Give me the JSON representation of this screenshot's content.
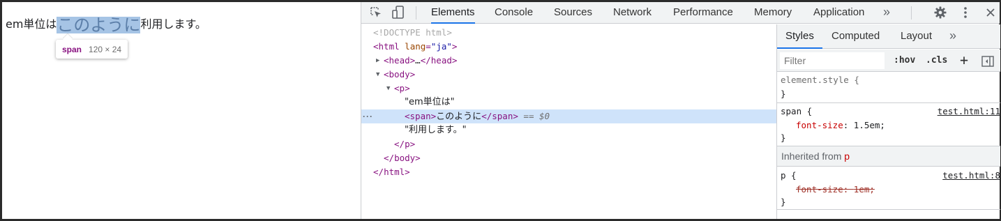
{
  "page": {
    "text_before": "em単位は",
    "text_highlight": "このように",
    "text_after": "利用します。",
    "tooltip_tag": "span",
    "tooltip_dims": "120 × 24"
  },
  "devtools": {
    "tabs": [
      "Elements",
      "Console",
      "Sources",
      "Network",
      "Performance",
      "Memory",
      "Application"
    ],
    "more": "»",
    "icons": [
      "inspect-icon",
      "device-toggle-icon",
      "gear-icon",
      "kebab-menu-icon",
      "close-icon"
    ]
  },
  "tree": {
    "doctype": "<!DOCTYPE html>",
    "html_open": "html",
    "lang_attr": "lang",
    "lang_value": "\"ja\"",
    "head": "head",
    "ellipsis": "…",
    "body": "body",
    "p": "p",
    "text1": "\"em単位は\"",
    "span": "span",
    "span_text": "このように",
    "eq": "==",
    "dollar": "$0",
    "text2": "\"利用します。\"",
    "dots": "···"
  },
  "styles": {
    "tabs": [
      "Styles",
      "Computed",
      "Layout"
    ],
    "more": "»",
    "filter_placeholder": "Filter",
    "hov": ":hov",
    "cls": ".cls",
    "plus": "+",
    "element_style": "element.style {",
    "close_brace": "}",
    "span_selector": "span {",
    "span_source": "test.html:11",
    "span_prop": "font-size",
    "span_value": "1.5em;",
    "inherited_label": "Inherited from",
    "inherited_tag": "p",
    "p_selector": "p {",
    "p_source": "test.html:8",
    "p_prop": "font-size",
    "p_value": "1em;"
  },
  "colors": {
    "highlight": "#a6c4e5",
    "tag": "#881280",
    "attr": "#994500",
    "attr_value": "#1a1aa6",
    "selected_row": "#cfe3fa",
    "active_tab": "#1a73e8",
    "prop_name": "#c80000"
  }
}
